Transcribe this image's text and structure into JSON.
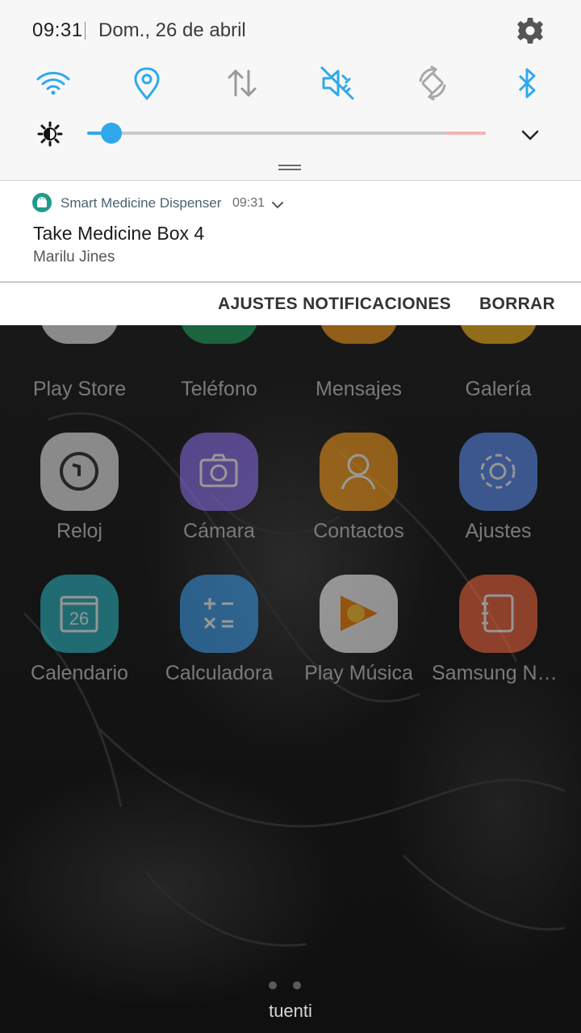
{
  "status": {
    "time": "09:31",
    "date": "Dom., 26 de abril"
  },
  "quick_settings": {
    "toggles": [
      {
        "icon": "wifi-icon",
        "on": true
      },
      {
        "icon": "location-icon",
        "on": true
      },
      {
        "icon": "mobile-data-icon",
        "on": false
      },
      {
        "icon": "sound-off-icon",
        "on": true
      },
      {
        "icon": "auto-rotate-icon",
        "on": false
      },
      {
        "icon": "bluetooth-icon",
        "on": true
      }
    ],
    "brightness_level": 0.06,
    "accent_color": "#2fa9ec"
  },
  "notification": {
    "app_name": "Smart Medicine Dispenser",
    "time": "09:31",
    "title": "Take Medicine Box 4",
    "body": "Marilu Jines",
    "app_icon": "android-icon",
    "app_icon_color": "#1f9a8a"
  },
  "actions": {
    "settings_label": "AJUSTES NOTIFICACIONES",
    "clear_label": "BORRAR"
  },
  "apps": [
    {
      "label": "Play Store",
      "icon": "play-store-icon",
      "color": "#e8e8e8"
    },
    {
      "label": "Teléfono",
      "icon": "phone-icon",
      "color": "#1fa463"
    },
    {
      "label": "Mensajes",
      "icon": "messages-icon",
      "color": "#f59a1a"
    },
    {
      "label": "Galería",
      "icon": "gallery-icon",
      "color": "#f5b41a"
    },
    {
      "label": "Reloj",
      "icon": "clock-icon",
      "color": "#e9e9e9"
    },
    {
      "label": "Cámara",
      "icon": "camera-icon",
      "color": "#8a6ee8"
    },
    {
      "label": "Contactos",
      "icon": "contacts-icon",
      "color": "#f59a1a"
    },
    {
      "label": "Ajustes",
      "icon": "settings-app-icon",
      "color": "#5b8df0"
    },
    {
      "label": "Calendario",
      "icon": "calendar-icon",
      "color": "#2bb3c0"
    },
    {
      "label": "Calculadora",
      "icon": "calculator-icon",
      "color": "#3c9be8"
    },
    {
      "label": "Play Música",
      "icon": "play-music-icon",
      "color": "#f2f2f2"
    },
    {
      "label": "Samsung Not…",
      "icon": "samsung-notes-icon",
      "color": "#f0643c"
    }
  ],
  "calendar_day": "26",
  "dock_label": "tuenti"
}
